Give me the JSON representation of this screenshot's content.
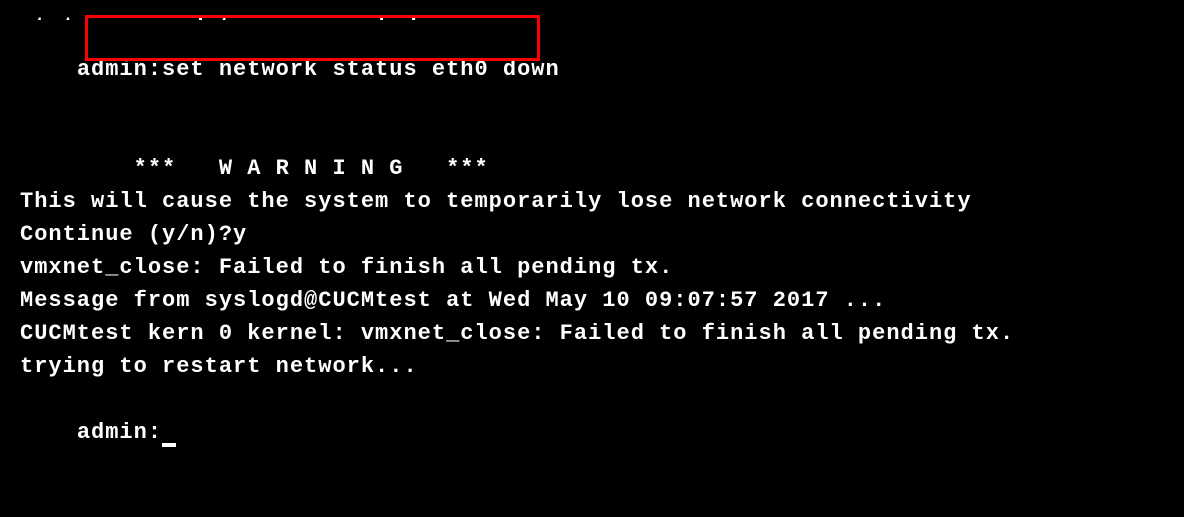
{
  "terminal": {
    "top_partial": "state    mandatory    up ¦ down",
    "prompt_cmd_prefix": "admin:",
    "cmd": "set network status eth0 down",
    "warning": "        ***   W A R N I N G   ***",
    "warn_msg": "This will cause the system to temporarily lose network connectivity",
    "blank": "",
    "continue_prompt": "Continue (y/n)?y",
    "vmx_close": "vmxnet_close: Failed to finish all pending tx.",
    "sys_msg": "Message from syslogd@CUCMtest at Wed May 10 09:07:57 2017 ...",
    "kern_msg": "CUCMtest kern 0 kernel: vmxnet_close: Failed to finish all pending tx.",
    "restart_msg": "trying to restart network...",
    "final_prompt": "admin:"
  },
  "highlight": {
    "color": "#ff0000"
  }
}
